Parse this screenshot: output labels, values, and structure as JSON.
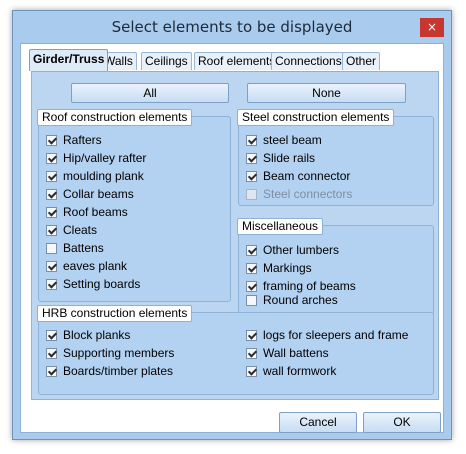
{
  "window": {
    "title": "Select elements to be displayed",
    "close_label": "×"
  },
  "tabs": [
    "Girder/Truss",
    "Walls",
    "Ceilings",
    "Roof elements",
    "Connections",
    "Other"
  ],
  "active_tab": "Girder/Truss",
  "buttons": {
    "all": "All",
    "none": "None",
    "cancel": "Cancel",
    "ok": "OK"
  },
  "groups": {
    "roof": {
      "title": "Roof construction elements",
      "items": [
        {
          "label": "Rafters",
          "checked": true
        },
        {
          "label": "Hip/valley rafter",
          "checked": true
        },
        {
          "label": "moulding plank",
          "checked": true
        },
        {
          "label": "Collar beams",
          "checked": true
        },
        {
          "label": "Roof beams",
          "checked": true
        },
        {
          "label": "Cleats",
          "checked": true
        },
        {
          "label": "Battens",
          "checked": false
        },
        {
          "label": "eaves plank",
          "checked": true
        },
        {
          "label": "Setting boards",
          "checked": true
        }
      ]
    },
    "steel": {
      "title": "Steel construction elements",
      "items": [
        {
          "label": "steel beam",
          "checked": true
        },
        {
          "label": "Slide rails",
          "checked": true
        },
        {
          "label": "Beam connector",
          "checked": true
        },
        {
          "label": "Steel connectors",
          "checked": false,
          "disabled": true
        }
      ]
    },
    "misc": {
      "title": "Miscellaneous",
      "items": [
        {
          "label": "Other lumbers",
          "checked": true
        },
        {
          "label": "Markings",
          "checked": true
        },
        {
          "label": "framing of beams",
          "checked": true
        },
        {
          "label": "Round arches",
          "checked": false
        }
      ]
    },
    "hrb": {
      "title": "HRB construction elements",
      "items_left": [
        {
          "label": "Block planks",
          "checked": true
        },
        {
          "label": "Supporting members",
          "checked": true
        },
        {
          "label": "Boards/timber plates",
          "checked": true
        }
      ],
      "items_right": [
        {
          "label": "logs for sleepers and frame",
          "checked": true
        },
        {
          "label": "Wall battens",
          "checked": true
        },
        {
          "label": "wall formwork",
          "checked": true
        }
      ]
    }
  }
}
